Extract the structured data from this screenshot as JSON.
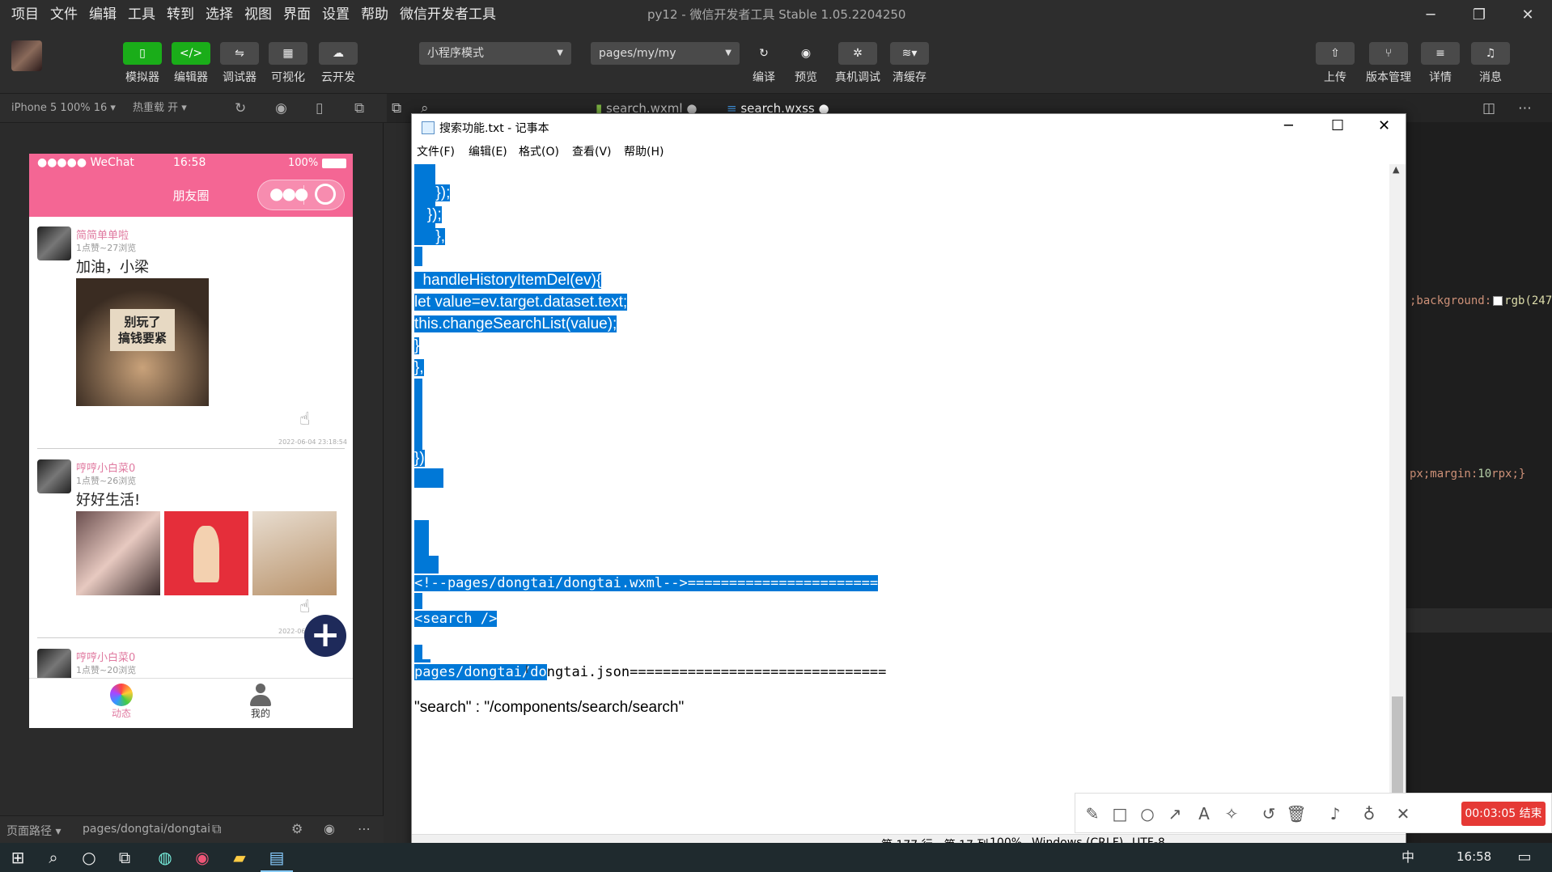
{
  "ide": {
    "menu": [
      "项目",
      "文件",
      "编辑",
      "工具",
      "转到",
      "选择",
      "视图",
      "界面",
      "设置",
      "帮助",
      "微信开发者工具"
    ],
    "window_title": "py12 - 微信开发者工具 Stable 1.05.2204250",
    "toolbar_left": [
      "模拟器",
      "编辑器",
      "调试器",
      "可视化",
      "云开发"
    ],
    "mode_select": "小程序模式",
    "page_select": "pages/my/my",
    "toolbar_mid": [
      "编译",
      "预览",
      "真机调试",
      "清缓存"
    ],
    "toolbar_right": [
      "上传",
      "版本管理",
      "详情",
      "消息"
    ],
    "device_select": "iPhone 5 100% 16 ▾",
    "hot_reload": "热重载 开 ▾",
    "tabs": [
      "search.wxml",
      "search.wxss"
    ],
    "code_right": [
      ";background:",
      "rgb(247,",
      "px;margin:",
      "10",
      "rpx;}"
    ],
    "bottom_path_label": "页面路径 ▾",
    "bottom_path": "pages/dongtai/dongtai",
    "colors": {
      "accent_green": "#1aad19",
      "phone_pink": "#f46694",
      "selection": "#0078d7"
    }
  },
  "phone": {
    "status": {
      "carrier": "●●●●● WeChat",
      "time": "16:58",
      "battery": "100%"
    },
    "nav_title": "朋友圈",
    "posts": [
      {
        "user": "简简单单啦",
        "meta": "1点赞~27浏览",
        "text": "加油，小梁",
        "image_text": "别玩了 搞钱要紧",
        "time": "2022-06-04 23:18:54"
      },
      {
        "user": "哼哼小白菜0",
        "meta": "1点赞~26浏览",
        "text": "好好生活!",
        "time": "2022-06"
      },
      {
        "user": "哼哼小白菜0",
        "meta": "1点赞~20浏览"
      }
    ],
    "tabbar": [
      "动态",
      "我的"
    ]
  },
  "notepad": {
    "title": "搜索功能.txt - 记事本",
    "menu": [
      "文件(F)",
      "编辑(E)",
      "格式(O)",
      "查看(V)",
      "帮助(H)"
    ],
    "lines": [
      "     });",
      "   });",
      "     },",
      "",
      "  handleHistoryItemDel(ev){",
      "let value=ev.target.dataset.text;",
      "this.changeSearchList(value);",
      "}",
      "},",
      "",
      "",
      "",
      "})",
      "",
      "",
      "",
      "",
      "",
      "<!--pages/dongtai/dongtai.wxml-->=======================",
      "",
      "<search />",
      "",
      "",
      "pages/dongtai/do",
      "ngtai.json===============================",
      "",
      "\"search\" : \"/components/search/search\""
    ],
    "status": {
      "position": "第 177 行，第 17 列",
      "zoom": "100%",
      "eol": "Windows (CRLF)",
      "encoding": "UTF-8"
    }
  },
  "recorder": {
    "end_label": "00:03:05 结束"
  },
  "taskbar": {
    "ime": "中",
    "time": "16:58"
  }
}
